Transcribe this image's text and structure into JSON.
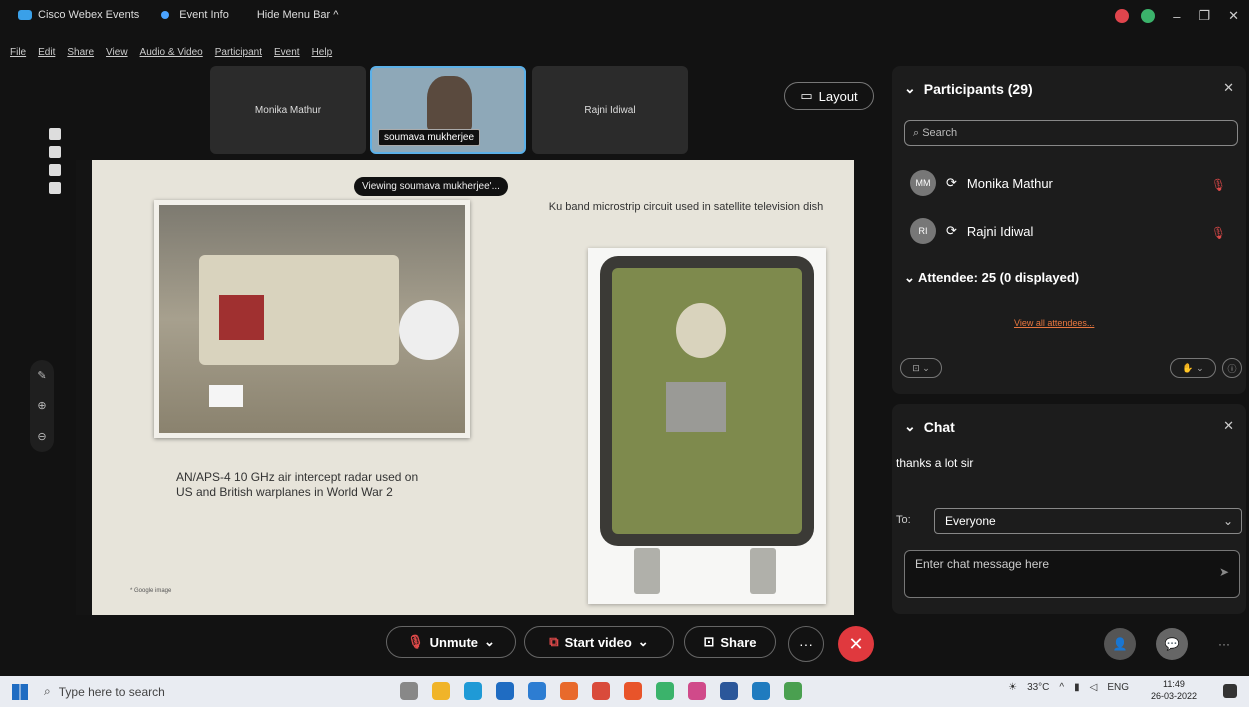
{
  "titlebar": {
    "app": "Cisco Webex Events",
    "event_info": "Event Info",
    "hide_menu": "Hide Menu Bar ^"
  },
  "menu": [
    "File",
    "Edit",
    "Share",
    "View",
    "Audio & Video",
    "Participant",
    "Event",
    "Help"
  ],
  "video_strip": {
    "tiles": [
      {
        "name": "Monika Mathur"
      },
      {
        "name": "soumava mukherjee"
      },
      {
        "name": "Rajni Idiwal"
      }
    ],
    "layout_label": "Layout"
  },
  "slide": {
    "tooltip": "Viewing soumava mukherjee'...",
    "caption_left": "AN/APS-4 10 GHz air intercept radar used on US and British warplanes in World War 2",
    "caption_right": "Ku band microstrip circuit used in satellite television dish",
    "source_note": "* Google image"
  },
  "controls": {
    "unmute": "Unmute",
    "start_video": "Start video",
    "share": "Share",
    "more": "···"
  },
  "participants": {
    "title": "Participants (29)",
    "search_placeholder": "Search",
    "people": [
      {
        "initials": "MM",
        "name": "Monika Mathur"
      },
      {
        "initials": "RI",
        "name": "Rajni Idiwal"
      }
    ],
    "attendee_header": "Attendee: 25 (0 displayed)",
    "view_all": "View all attendees..."
  },
  "chat": {
    "title": "Chat",
    "message": "thanks a lot sir",
    "to_label": "To:",
    "to_value": "Everyone",
    "input_placeholder": "Enter chat message here"
  },
  "taskbar": {
    "search_placeholder": "Type here to search",
    "weather": "33°C",
    "lang": "ENG",
    "time": "11:49",
    "date": "26-03-2022"
  },
  "colors": {
    "accent_blue": "#5bb0e8",
    "mute_red": "#e04a4a",
    "link_orange": "#e9773f",
    "end_call": "#e0393e"
  }
}
